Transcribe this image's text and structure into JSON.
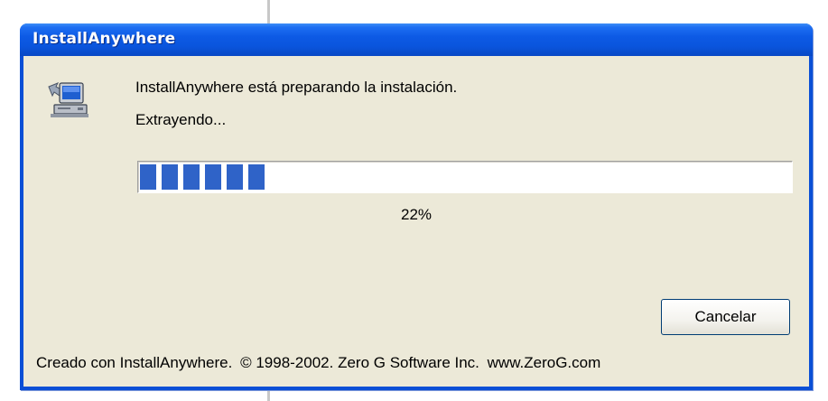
{
  "window": {
    "title": "InstallAnywhere"
  },
  "message": {
    "line1": "InstallAnywhere está preparando la instalación.",
    "line2": "Extrayendo..."
  },
  "progress": {
    "value": 0.22,
    "label": "22%"
  },
  "buttons": {
    "cancel_label": "Cancelar"
  },
  "footer": {
    "credit": "Creado con InstallAnywhere.",
    "copyright": "© 1998-2002. Zero G Software Inc.",
    "url": "www.ZeroG.com"
  },
  "colors": {
    "titlebar": "#0a55dd",
    "progress_fill": "#2f63c8",
    "dialog_background": "#ece9d8"
  },
  "icons": {
    "installer": "computer-install-icon"
  }
}
